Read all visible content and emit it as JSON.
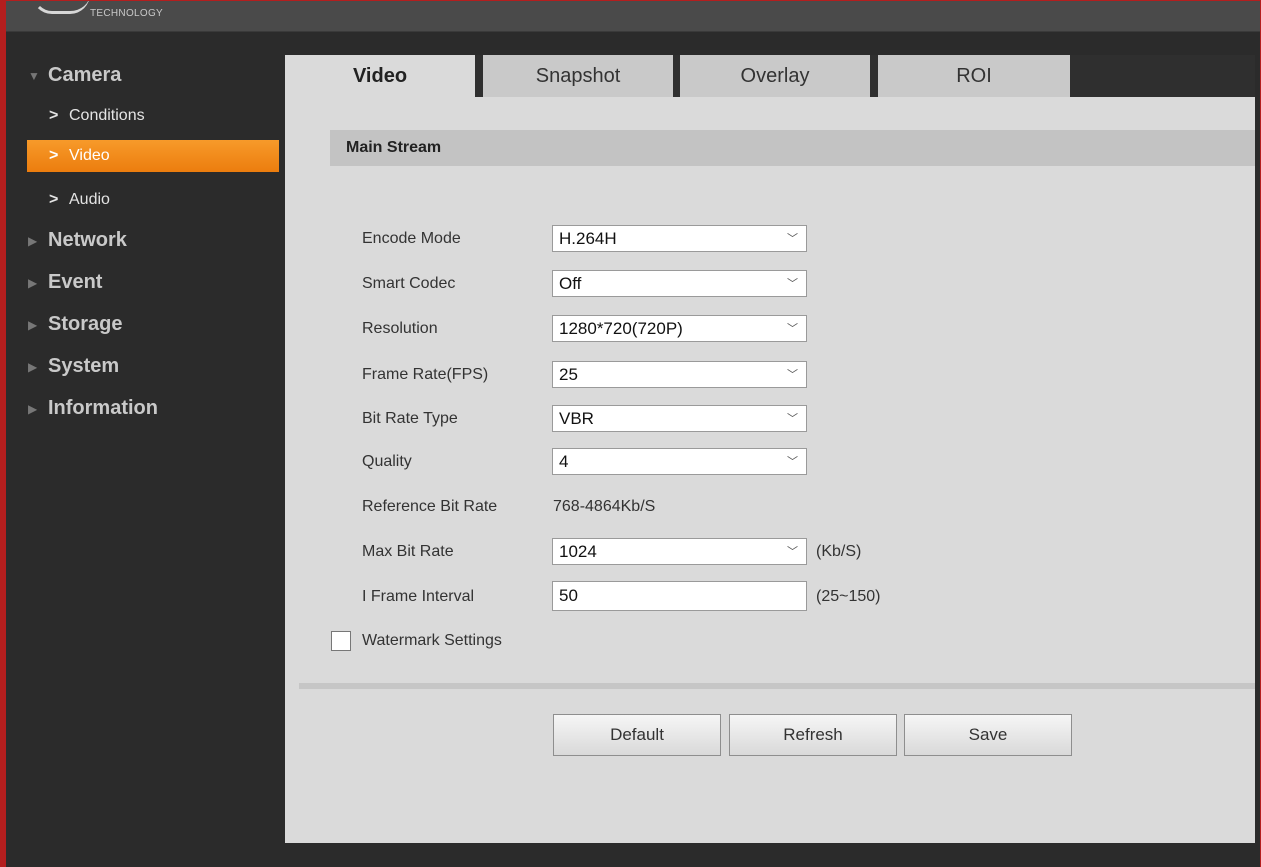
{
  "header": {
    "logo_text": "TECHNOLOGY"
  },
  "sidebar": {
    "camera": {
      "label": "Camera",
      "expanded": true
    },
    "sub_items": [
      {
        "label": "Conditions",
        "selected": false
      },
      {
        "label": "Video",
        "selected": true
      },
      {
        "label": "Audio",
        "selected": false
      }
    ],
    "items": [
      {
        "label": "Network"
      },
      {
        "label": "Event"
      },
      {
        "label": "Storage"
      },
      {
        "label": "System"
      },
      {
        "label": "Information"
      }
    ],
    "accent_color": "#f08a1a"
  },
  "tabs": [
    {
      "label": "Video",
      "active": true
    },
    {
      "label": "Snapshot",
      "active": false
    },
    {
      "label": "Overlay",
      "active": false
    },
    {
      "label": "ROI",
      "active": false
    }
  ],
  "section": {
    "title": "Main Stream"
  },
  "form": {
    "encode_mode": {
      "label": "Encode Mode",
      "value": "H.264H"
    },
    "smart_codec": {
      "label": "Smart Codec",
      "value": "Off"
    },
    "resolution": {
      "label": "Resolution",
      "value": "1280*720(720P)"
    },
    "frame_rate": {
      "label": "Frame Rate(FPS)",
      "value": "25"
    },
    "bit_rate_type": {
      "label": "Bit Rate Type",
      "value": "VBR"
    },
    "quality": {
      "label": "Quality",
      "value": "4"
    },
    "reference_bit_rate": {
      "label": "Reference Bit Rate",
      "value": "768-4864Kb/S"
    },
    "max_bit_rate": {
      "label": "Max Bit Rate",
      "value": "1024",
      "unit": "(Kb/S)"
    },
    "i_frame_interval": {
      "label": "I Frame Interval",
      "value": "50",
      "range": "(25~150)"
    },
    "watermark": {
      "label": "Watermark Settings",
      "checked": false
    }
  },
  "buttons": {
    "default_label": "Default",
    "refresh_label": "Refresh",
    "save_label": "Save"
  }
}
